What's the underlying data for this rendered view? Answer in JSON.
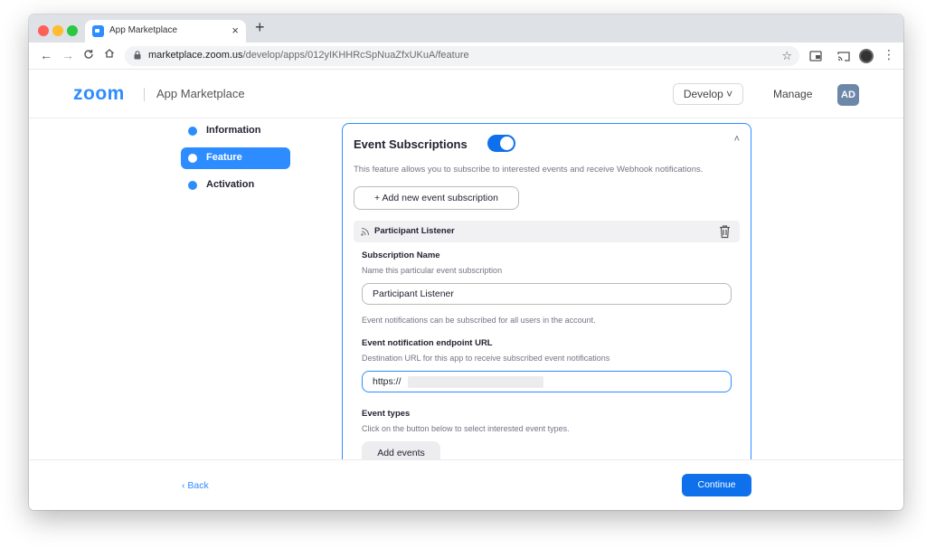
{
  "browser": {
    "tab_title": "App Marketplace",
    "tab_close": "×",
    "new_tab": "+",
    "url_host": "marketplace.zoom.us",
    "url_path": "/develop/apps/012yIKHHRcSpNuaZfxUKuA/feature",
    "nav": {
      "back": "←",
      "forward": "→",
      "reload": "C",
      "home": "⌂"
    },
    "star": "☆",
    "menu": "⋮"
  },
  "header": {
    "logo": "zoom",
    "title": "App Marketplace",
    "develop_label": "Develop ˅",
    "manage_label": "Manage",
    "avatar_initials": "AD"
  },
  "sidebar": {
    "items": [
      {
        "label": "Information",
        "active": false
      },
      {
        "label": "Feature",
        "active": true
      },
      {
        "label": "Activation",
        "active": false
      }
    ]
  },
  "event_subscriptions": {
    "title": "Event Subscriptions",
    "enabled": true,
    "collapse": "˄",
    "description": "This feature allows you to subscribe to interested events and receive Webhook notifications.",
    "add_button": "+  Add new event subscription",
    "subscription": {
      "header_title": "Participant Listener",
      "name_label": "Subscription Name",
      "name_help": "Name this particular event subscription",
      "name_value": "Participant Listener",
      "scope_note": "Event notifications can be subscribed for all users in the account.",
      "url_label": "Event notification endpoint URL",
      "url_help": "Destination URL for this app to receive subscribed event notifications",
      "url_value": "https://",
      "types_label": "Event types",
      "types_help": "Click on the button below to select interested event types.",
      "add_events_label": "Add events"
    }
  },
  "footer": {
    "back_label": "‹ Back",
    "continue_label": "Continue"
  },
  "colors": {
    "brand_blue": "#2d8cff",
    "primary_button": "#0e71eb"
  }
}
